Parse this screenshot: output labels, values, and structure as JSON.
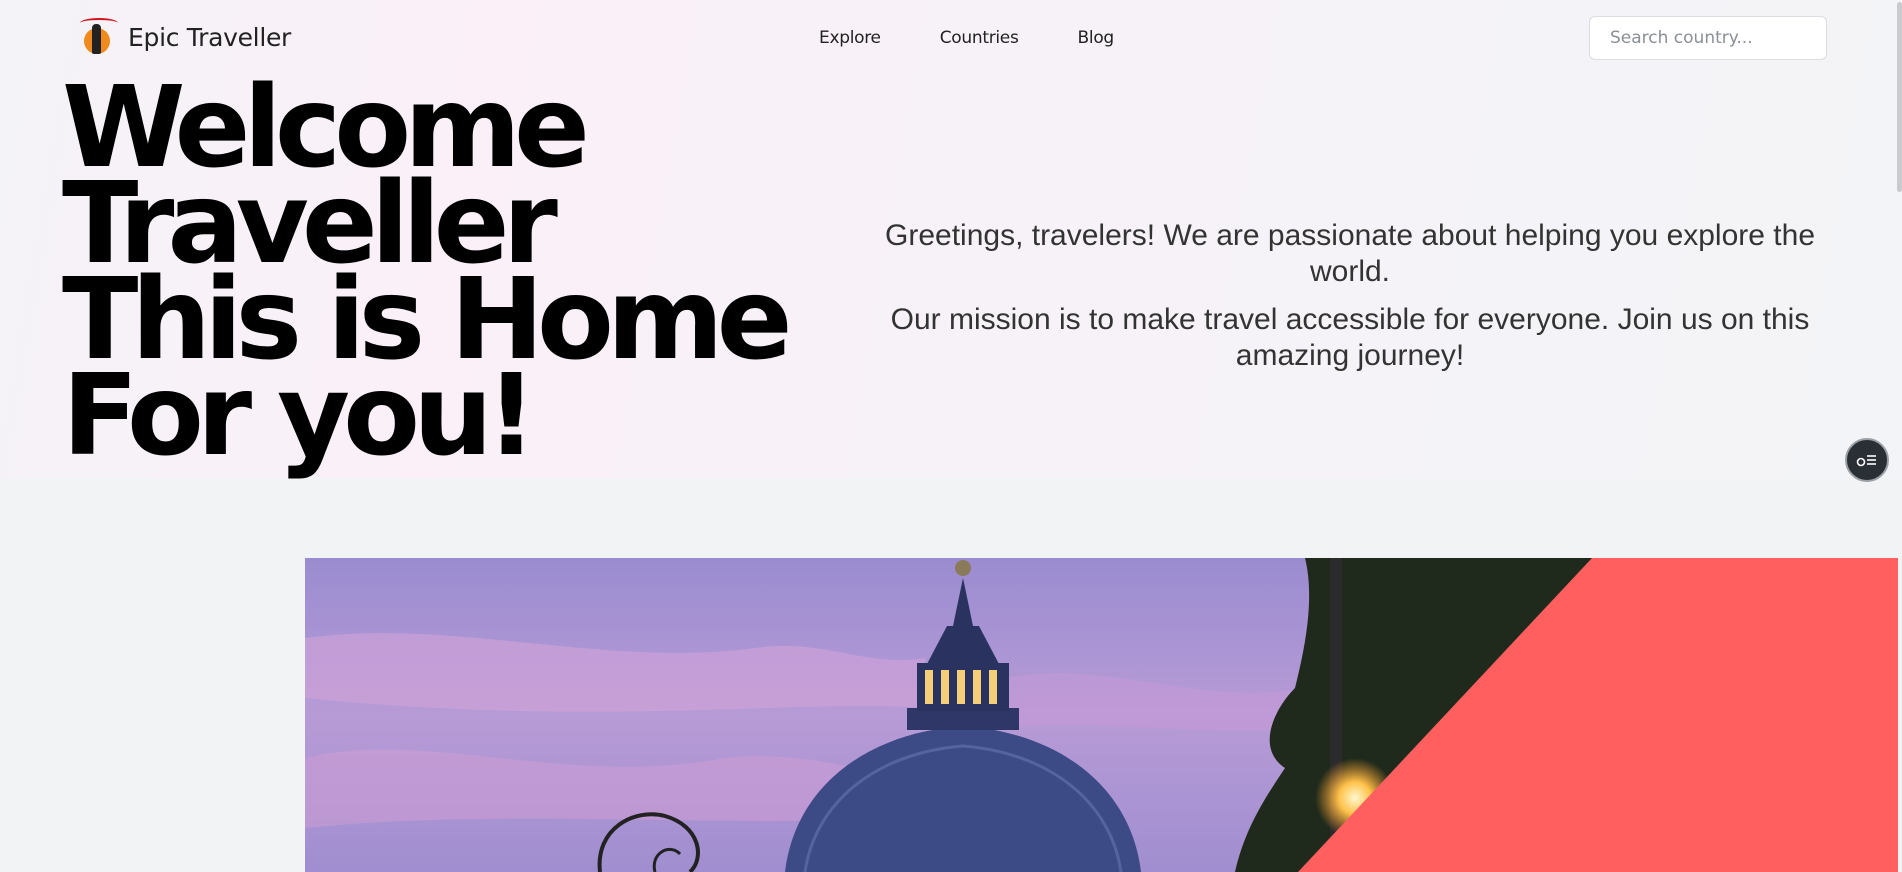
{
  "header": {
    "brand": "Epic Traveller",
    "nav": [
      "Explore",
      "Countries",
      "Blog"
    ],
    "search_placeholder": "Search country..."
  },
  "hero": {
    "title_lines": [
      "Welcome",
      "Traveller",
      "This is Home",
      "For you!"
    ],
    "paragraphs": [
      "Greetings, travelers! We are passionate about helping you explore the world.",
      "Our mission is to make travel accessible for everyone. Join us on this amazing journey!"
    ]
  },
  "colors": {
    "accent_coral": "#ff5f5f",
    "sky_purple": "#a493d6",
    "dome_blue": "#3c4a86"
  },
  "icons": {
    "logo": "traveller-silhouette-logo",
    "floating": "settings-toggle-icon"
  }
}
